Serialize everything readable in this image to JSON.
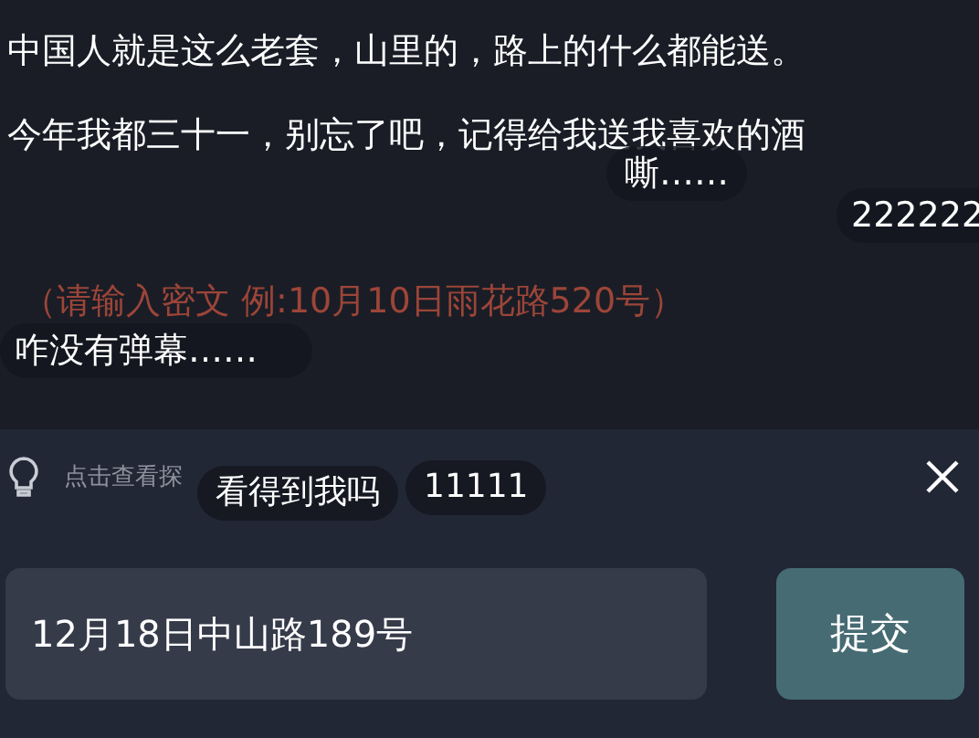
{
  "comments": [
    "中国人就是这么老套，山里的，路上的什么都能送。",
    "今年我都三十一，别忘了吧，记得给我送我喜欢的酒"
  ],
  "answer_hint": "（请输入密文 例:10月10日雨花路520号）",
  "danmaku": [
    "嘶……",
    "222222",
    "咋没有弹幕……",
    "看得到我吗",
    "11111"
  ],
  "clue_hint": "点击查看探",
  "answer_field": {
    "value": "12月18日中山路189号"
  },
  "submit_button": "提交"
}
